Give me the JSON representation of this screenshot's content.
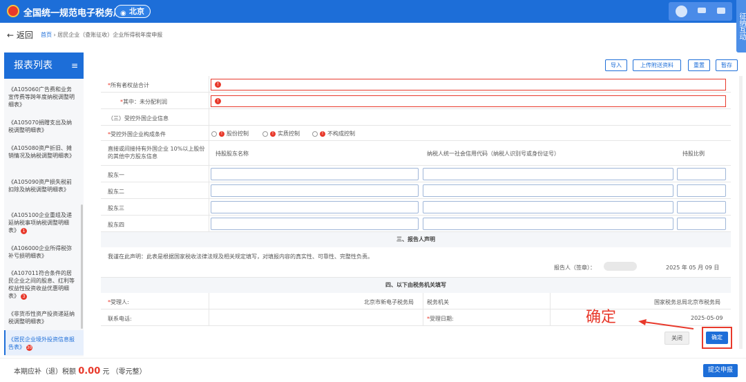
{
  "header": {
    "brand": "全国统一规范电子税务局",
    "city": "北京",
    "side_tab": "征纳互动"
  },
  "nav": {
    "back": "返回",
    "breadcrumb_home": "首页",
    "breadcrumb_sep": " › ",
    "breadcrumb_page": "居民企业（查账征收）企业所得税年度申报"
  },
  "sidebar": {
    "title": "报表列表",
    "items": [
      {
        "label": "《A105060广告费和业务宣传费等跨年度纳税调整明细表》"
      },
      {
        "label": "《A105070捐赠支出及纳税调整明细表》"
      },
      {
        "label": "《A105080资产折旧、摊销情况及纳税调整明细表》"
      },
      {
        "label": "《A105090资产损失税前扣除及纳税调整明细表》"
      },
      {
        "label": "《A105100企业重组及递延纳税事项纳税调整明细表》",
        "badge": "1"
      },
      {
        "label": "《A106000企业所得税弥补亏损明细表》"
      },
      {
        "label": "《A107011符合条件的居民企业之间的股息、红利等权益性投资收益优惠明细表》",
        "badge": "3"
      },
      {
        "label": "《非货币性资产投资递延纳税调整明细表》"
      },
      {
        "label": "《居民企业境外投资信息报告表》",
        "badge": "30"
      }
    ]
  },
  "toolbar": {
    "import": "导入",
    "upload": "上传附送资料",
    "reset": "重置",
    "save": "暂存"
  },
  "form": {
    "equity_total": "所有者权益合计",
    "undistributed": "其中：未分配利润",
    "section3": "（三）受控外国企业信息",
    "cfc_condition": "受控外国企业构成条件",
    "radios": [
      "股份控制",
      "实质控制",
      "不构成控制"
    ],
    "holder_header": "直接或间接持有外国企业 10%以上股份的其他中方股东信息",
    "col_name": "持股股东名称",
    "col_code": "纳税人统一社会信用代码（纳税人识别号或身份证号）",
    "col_ratio": "持股比例",
    "holders": [
      "股东一",
      "股东二",
      "股东三",
      "股东四"
    ],
    "section_declare": "三、报告人声明",
    "declare_text": "我谨在此声明：此表是根据国家税收法律法规及相关规定填写，对填报内容的真实性、可靠性、完整性负责。",
    "reporter": "报告人（签章）：",
    "report_date": "2025 年 05 月 09 日",
    "section_tax": "四、以下由税务机关填写",
    "receiver_label": "受理人:",
    "receiver_value": "北京市新电子税务局",
    "authority_label": "税务机关",
    "authority_value": "国家税务总局北京市税务局",
    "phone_label": "联系电话:",
    "date_label": "受理日期:",
    "date_value": "2025-05-09"
  },
  "annotation": "确定",
  "dialog": {
    "close": "关闭",
    "confirm": "确定"
  },
  "footer": {
    "tax_prefix": "本期应补（退）税额",
    "tax_amount": "0.00",
    "tax_suffix": "元 （零元整）",
    "submit": "提交申报"
  },
  "colors": {
    "primary": "#1d6ed8",
    "error": "#e8392b"
  }
}
